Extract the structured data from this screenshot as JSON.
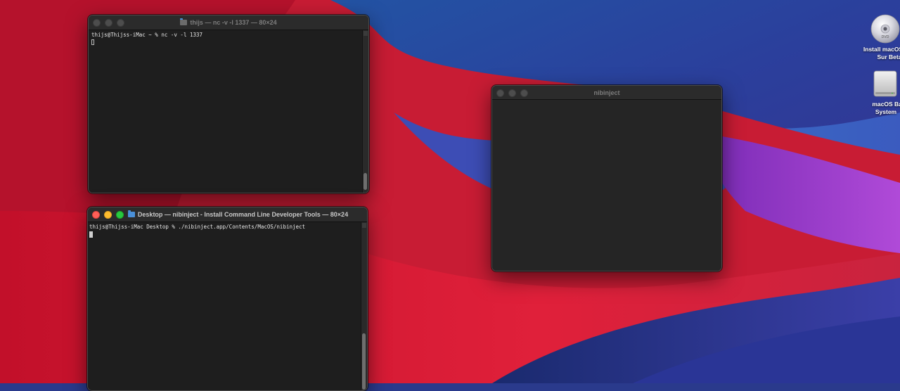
{
  "wallpaper": {
    "name": "macOS Big Sur wallpaper"
  },
  "terminal_top": {
    "title": "thijs — nc -v -l 1337 — 80×24",
    "prompt": "thijs@Thijss-iMac ~ % nc -v -l 1337",
    "active": false
  },
  "terminal_bottom": {
    "title": "Desktop — nibinject - Install Command Line Developer Tools — 80×24",
    "prompt": "thijs@Thijss-iMac Desktop % ./nibinject.app/Contents/MacOS/nibinject",
    "folder_icon": "folder-icon",
    "active": true
  },
  "nibinject_window": {
    "title": "nibinject"
  },
  "desktop_items": [
    {
      "label_line1": "Install macOS",
      "label_line2": "Sur Beta",
      "icon": "dvd-disc-icon"
    },
    {
      "label_line1": "macOS Bas",
      "label_line2": "System",
      "icon": "hard-disk-icon"
    }
  ],
  "colors": {
    "close": "#ff5f57",
    "minimize": "#febc2e",
    "zoom": "#28c840",
    "terminal_bg": "#1e1e1e",
    "titlebar_bg": "#2b2b2b"
  }
}
